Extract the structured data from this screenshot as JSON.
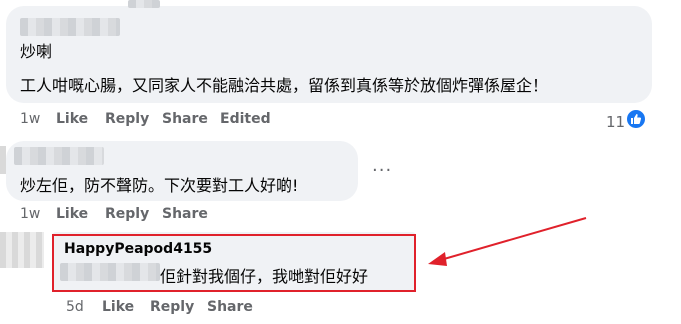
{
  "comments": [
    {
      "line1": "炒喇",
      "line2": "工人咁嘅心腸，又同家人不能融洽共處，留係到真係等於放個炸彈係屋企！",
      "time": "1w",
      "like": "Like",
      "reply": "Reply",
      "share": "Share",
      "edited": "Edited",
      "reaction_count": "11"
    },
    {
      "text": "炒左佢，防不聲防。下次要對工人好啲!",
      "time": "1w",
      "like": "Like",
      "reply": "Reply",
      "share": "Share",
      "more": "···"
    },
    {
      "author": "HappyPeapod4155",
      "text": "佢針對我個仔，我哋對佢好好",
      "time": "5d",
      "like": "Like",
      "reply": "Reply",
      "share": "Share"
    }
  ],
  "colors": {
    "bubble": "#f0f2f5",
    "meta": "#65676b",
    "like_blue": "#1877f2",
    "annotation_red": "#e0212b"
  },
  "icons": [
    "like-icon",
    "more-icon",
    "arrow-icon"
  ]
}
